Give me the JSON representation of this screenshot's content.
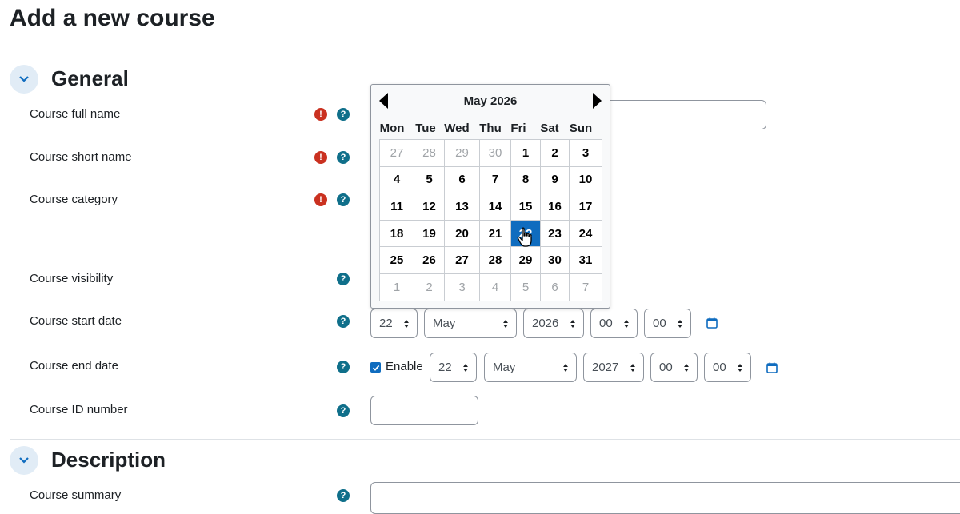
{
  "page": {
    "title": "Add a new course"
  },
  "sections": {
    "general": {
      "title": "General"
    },
    "description": {
      "title": "Description"
    }
  },
  "fields": {
    "fullname": {
      "label": "Course full name",
      "value": ""
    },
    "shortname": {
      "label": "Course short name"
    },
    "category": {
      "label": "Course category"
    },
    "visibility": {
      "label": "Course visibility"
    },
    "startdate": {
      "label": "Course start date",
      "day": "22",
      "month": "May",
      "year": "2026",
      "hour": "00",
      "minute": "00"
    },
    "enddate": {
      "label": "Course end date",
      "enable_label": "Enable",
      "enabled": true,
      "day": "22",
      "month": "May",
      "year": "2027",
      "hour": "00",
      "minute": "00"
    },
    "idnumber": {
      "label": "Course ID number",
      "value": ""
    },
    "summary": {
      "label": "Course summary"
    }
  },
  "icons": {
    "required": "!",
    "help": "?"
  },
  "calendar": {
    "month_label": "May 2026",
    "weekdays": [
      "Mon",
      "Tue",
      "Wed",
      "Thu",
      "Fri",
      "Sat",
      "Sun"
    ],
    "weeks": [
      [
        {
          "d": "27",
          "muted": true
        },
        {
          "d": "28",
          "muted": true
        },
        {
          "d": "29",
          "muted": true
        },
        {
          "d": "30",
          "muted": true
        },
        {
          "d": "1"
        },
        {
          "d": "2"
        },
        {
          "d": "3"
        }
      ],
      [
        {
          "d": "4"
        },
        {
          "d": "5"
        },
        {
          "d": "6"
        },
        {
          "d": "7"
        },
        {
          "d": "8"
        },
        {
          "d": "9"
        },
        {
          "d": "10"
        }
      ],
      [
        {
          "d": "11"
        },
        {
          "d": "12"
        },
        {
          "d": "13"
        },
        {
          "d": "14"
        },
        {
          "d": "15"
        },
        {
          "d": "16"
        },
        {
          "d": "17"
        }
      ],
      [
        {
          "d": "18"
        },
        {
          "d": "19"
        },
        {
          "d": "20"
        },
        {
          "d": "21"
        },
        {
          "d": "22",
          "selected": true
        },
        {
          "d": "23"
        },
        {
          "d": "24"
        }
      ],
      [
        {
          "d": "25"
        },
        {
          "d": "26"
        },
        {
          "d": "27"
        },
        {
          "d": "28"
        },
        {
          "d": "29"
        },
        {
          "d": "30"
        },
        {
          "d": "31"
        }
      ],
      [
        {
          "d": "1",
          "muted": true
        },
        {
          "d": "2",
          "muted": true
        },
        {
          "d": "3",
          "muted": true
        },
        {
          "d": "4",
          "muted": true
        },
        {
          "d": "5",
          "muted": true
        },
        {
          "d": "6",
          "muted": true
        },
        {
          "d": "7",
          "muted": true
        }
      ]
    ]
  },
  "colors": {
    "accent": "#0f6cbf",
    "required": "#ca3120",
    "help": "#0f6f8a"
  }
}
